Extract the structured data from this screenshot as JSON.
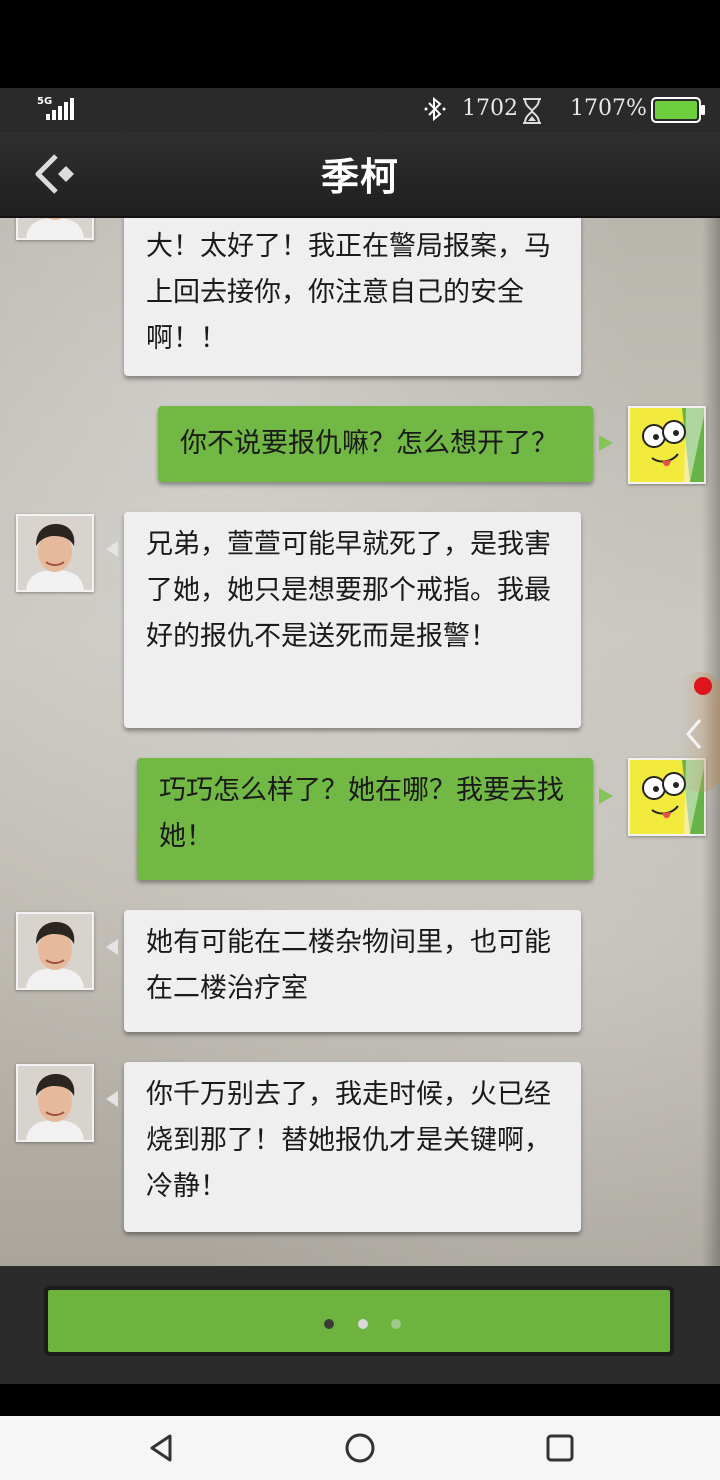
{
  "status_bar": {
    "network": "5G",
    "value1": "1702",
    "value2": "1707%"
  },
  "header": {
    "title": "季柯"
  },
  "messages": [
    {
      "side": "left",
      "text": "大！太好了！我正在警局报案，马上回去接你，你注意自己的安全啊！！"
    },
    {
      "side": "right",
      "text": "你不说要报仇嘛？怎么想开了？"
    },
    {
      "side": "left",
      "text": "兄弟，萱萱可能早就死了，是我害了她，她只是想要那个戒指。我最好的报仇不是送死而是报警！"
    },
    {
      "side": "right",
      "text": "巧巧怎么样了？她在哪？我要去找她！"
    },
    {
      "side": "left",
      "text": "她有可能在二楼杂物间里，也可能在二楼治疗室"
    },
    {
      "side": "left",
      "text": "你千万别去了，我走时候，火已经烧到那了！替她报仇才是关键啊，冷静！"
    }
  ],
  "input": {
    "state": "typing",
    "dots": 3
  },
  "colors": {
    "bubble_left": "#efefef",
    "bubble_right": "#72b844",
    "accent_green": "#6db43f",
    "notification_dot": "#e0141d"
  },
  "icons": {
    "back": "back-arrow-icon",
    "bluetooth": "bluetooth-icon",
    "hourglass": "hourglass-icon",
    "battery": "battery-icon",
    "nav_back": "nav-back-icon",
    "nav_home": "nav-home-icon",
    "nav_recents": "nav-recents-icon"
  }
}
